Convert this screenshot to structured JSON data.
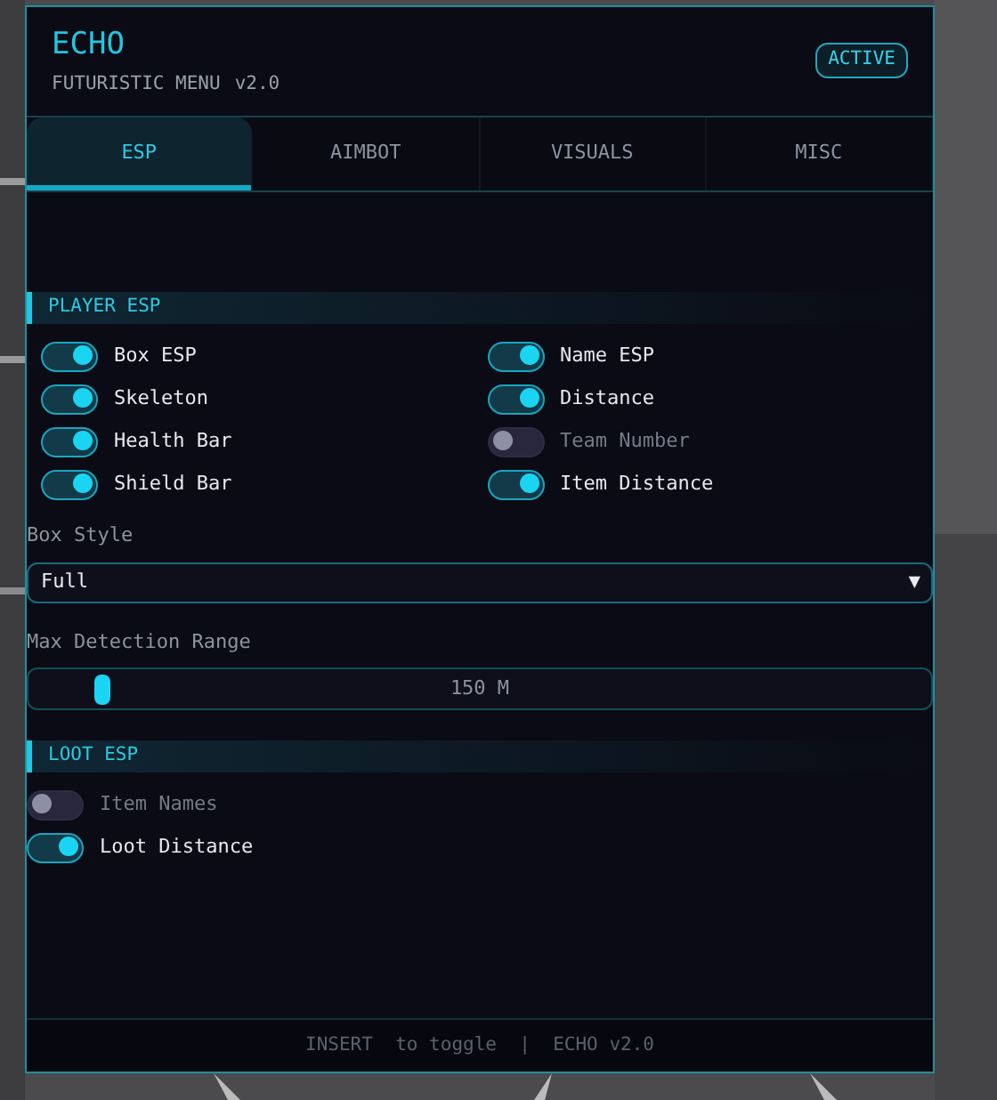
{
  "header": {
    "title": "ECHO",
    "subtitle": "FUTURISTIC MENU",
    "version": "v2.0",
    "badge": "ACTIVE"
  },
  "tabs": [
    {
      "label": "ESP",
      "selected": true
    },
    {
      "label": "AIMBOT",
      "selected": false
    },
    {
      "label": "VISUALS",
      "selected": false
    },
    {
      "label": "MISC",
      "selected": false
    }
  ],
  "content": [
    {
      "kind": "gridsection",
      "title": "PLAYER ESP",
      "toggles": [
        {
          "label": "Box ESP",
          "on": true
        },
        {
          "label": "Name ESP",
          "on": true
        },
        {
          "label": "Skeleton",
          "on": true
        },
        {
          "label": "Distance",
          "on": true
        },
        {
          "label": "Health Bar",
          "on": true
        },
        {
          "label": "Team Number",
          "on": false
        },
        {
          "label": "Shield Bar",
          "on": true
        },
        {
          "label": "Item Distance",
          "on": true
        }
      ]
    },
    {
      "kind": "select",
      "label": "Box Style",
      "value": "Full",
      "arrow": "▼"
    },
    {
      "kind": "slider",
      "label": "Max Detection Range",
      "level": 0.08,
      "reading": "150 M"
    },
    {
      "kind": "listsection",
      "title": "LOOT ESP",
      "toggles": [
        {
          "label": "Item Names",
          "on": false
        },
        {
          "label": "Loot Distance",
          "on": true
        }
      ]
    }
  ],
  "footer": "INSERT  to toggle  |  ECHO v2.0"
}
